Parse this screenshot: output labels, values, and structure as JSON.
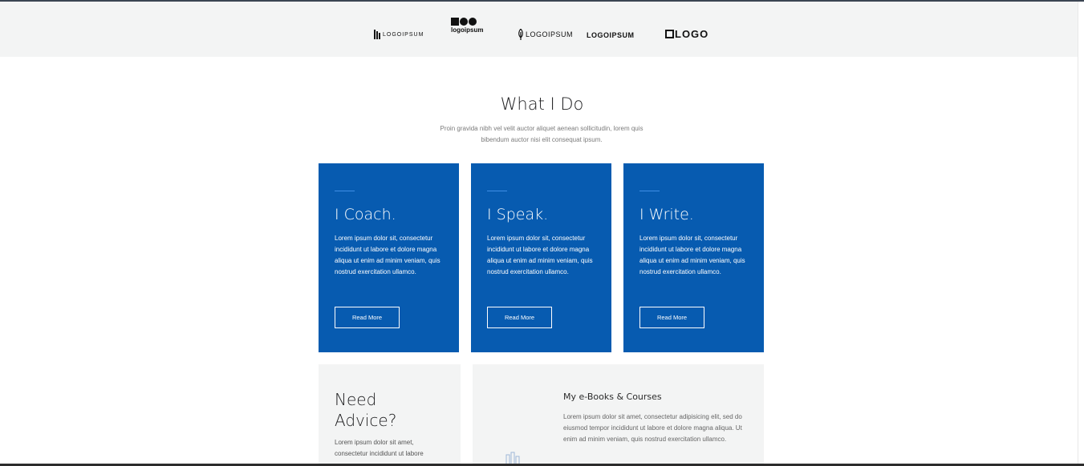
{
  "logos": [
    {
      "text": "LOGOIPSUM",
      "name": "logo-bars"
    },
    {
      "text": "logoipsum",
      "name": "logo-shapes"
    },
    {
      "text": "LOGOIPSUM",
      "name": "logo-leaf"
    },
    {
      "text": "LOGOIPSUM",
      "name": "logo-outline"
    },
    {
      "text": "LOGO",
      "name": "logo-square"
    }
  ],
  "section": {
    "title": "What I Do",
    "subtitle": "Proin gravida nibh vel velit auctor aliquet aenean sollicitudin, lorem quis bibendum auctor nisi elit consequat ipsum."
  },
  "cards": [
    {
      "title": "I Coach.",
      "text": "Lorem ipsum dolor sit, consectetur incididunt ut labore et dolore magna aliqua ut enim ad minim veniam, quis nostrud exercitation ullamco.",
      "button": "Read More"
    },
    {
      "title": "I Speak.",
      "text": "Lorem ipsum dolor sit, consectetur incididunt ut labore et dolore magna aliqua ut enim ad minim veniam, quis nostrud exercitation ullamco.",
      "button": "Read More"
    },
    {
      "title": "I Write.",
      "text": "Lorem ipsum dolor sit, consectetur incididunt ut labore et dolore magna aliqua ut enim ad minim veniam, quis nostrud exercitation ullamco.",
      "button": "Read More"
    }
  ],
  "advice": {
    "title": "Need Advice?",
    "text": "Lorem ipsum dolor sit amet, consectetur incididunt ut labore"
  },
  "ebooks": {
    "title": "My e-Books & Courses",
    "text": "Lorem ipsum dolor sit amet, consectetur adipisicing elit, sed do eiusmod tempor incididunt ut labore et dolore magna aliqua. Ut enim ad minim veniam, quis nostrud exercitation ullamco."
  },
  "colors": {
    "card_blue": "#075bb0",
    "band_grey": "#f3f4f4"
  }
}
